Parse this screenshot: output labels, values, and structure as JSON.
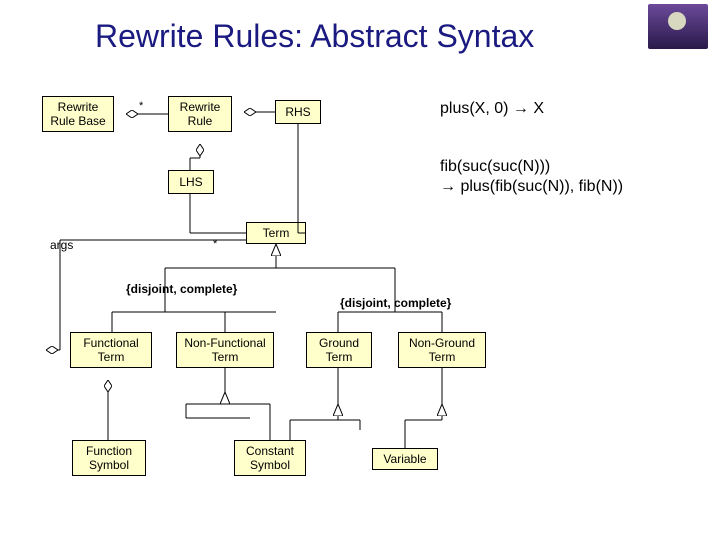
{
  "title": "Rewrite Rules: Abstract Syntax",
  "examples": {
    "ex1": "plus(X, 0) → X",
    "ex2a": "fib(suc(suc(N)))",
    "ex2b": "→ plus(fib(suc(N)), fib(N))"
  },
  "boxes": {
    "rewrite_rule_base": "Rewrite\nRule Base",
    "rewrite_rule": "Rewrite\nRule",
    "rhs": "RHS",
    "lhs": "LHS",
    "term": "Term",
    "functional_term": "Functional\nTerm",
    "non_functional_term": "Non-Functional\nTerm",
    "ground_term": "Ground\nTerm",
    "non_ground_term": "Non-Ground\nTerm",
    "function_symbol": "Function\nSymbol",
    "constant_symbol": "Constant\nSymbol",
    "variable": "Variable"
  },
  "labels": {
    "args": "args",
    "star1": "*",
    "star2": "*",
    "constraint": "{disjoint, complete}"
  }
}
